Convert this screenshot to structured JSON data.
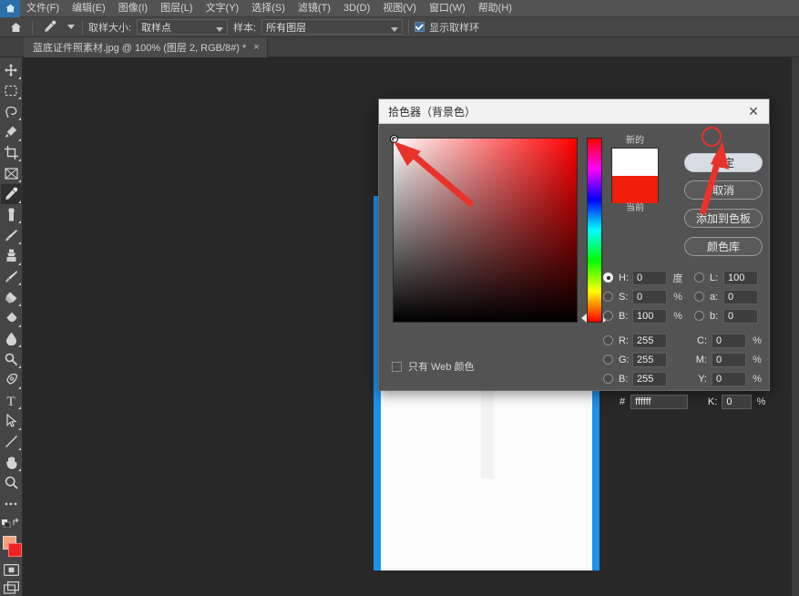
{
  "app": {
    "home_icon": "home-icon"
  },
  "menubar": {
    "items": [
      {
        "label": "文件(F)"
      },
      {
        "label": "编辑(E)"
      },
      {
        "label": "图像(I)"
      },
      {
        "label": "图层(L)"
      },
      {
        "label": "文字(Y)"
      },
      {
        "label": "选择(S)"
      },
      {
        "label": "滤镜(T)"
      },
      {
        "label": "3D(D)"
      },
      {
        "label": "视图(V)"
      },
      {
        "label": "窗口(W)"
      },
      {
        "label": "帮助(H)"
      }
    ]
  },
  "optionsbar": {
    "tool_icon": "eyedropper-icon",
    "sample_size_label": "取样大小:",
    "sample_size_value": "取样点",
    "sample_label": "样本:",
    "sample_value": "所有图层",
    "show_ring_label": "显示取样环",
    "show_ring_checked": true
  },
  "tabbar": {
    "document_title": "蓝底证件照素材.jpg @ 100% (图层 2, RGB/8#) *",
    "close_glyph": "×"
  },
  "toolbar": {
    "tools": [
      {
        "name": "move-tool"
      },
      {
        "name": "rectangular-marquee-tool"
      },
      {
        "name": "lasso-tool"
      },
      {
        "name": "quick-selection-tool"
      },
      {
        "name": "crop-tool"
      },
      {
        "name": "frame-tool"
      },
      {
        "name": "eyedropper-tool",
        "active": true
      },
      {
        "name": "spot-healing-brush-tool"
      },
      {
        "name": "brush-tool"
      },
      {
        "name": "clone-stamp-tool"
      },
      {
        "name": "history-brush-tool"
      },
      {
        "name": "eraser-tool"
      },
      {
        "name": "gradient-tool"
      },
      {
        "name": "blur-tool"
      },
      {
        "name": "dodge-tool"
      },
      {
        "name": "pen-tool"
      },
      {
        "name": "type-tool"
      },
      {
        "name": "path-selection-tool"
      },
      {
        "name": "line-tool"
      },
      {
        "name": "hand-tool"
      },
      {
        "name": "zoom-tool"
      },
      {
        "name": "edit-toolbar-tool"
      }
    ],
    "foreground_color": "#f3a178",
    "background_color": "#ee2222"
  },
  "dialog": {
    "title": "拾色器（背景色）",
    "close_glyph": "✕",
    "buttons": {
      "ok": "确定",
      "cancel": "取消",
      "add_to_swatches": "添加到色板",
      "color_libraries": "颜色库"
    },
    "preview": {
      "new_label": "新的",
      "current_label": "当前",
      "new_color": "#ffffff",
      "current_color": "#f01e0a"
    },
    "web_only": {
      "label": "只有 Web 颜色",
      "checked": false
    },
    "hsb": [
      {
        "key": "H:",
        "value": "0",
        "unit": "度",
        "selected": true
      },
      {
        "key": "S:",
        "value": "0",
        "unit": "%",
        "selected": false
      },
      {
        "key": "B:",
        "value": "100",
        "unit": "%",
        "selected": false
      }
    ],
    "lab": [
      {
        "key": "L:",
        "value": "100",
        "unit": "",
        "selected": false
      },
      {
        "key": "a:",
        "value": "0",
        "unit": "",
        "selected": false
      },
      {
        "key": "b:",
        "value": "0",
        "unit": "",
        "selected": false
      }
    ],
    "rgb": [
      {
        "key": "R:",
        "value": "255",
        "selected": false
      },
      {
        "key": "G:",
        "value": "255",
        "selected": false
      },
      {
        "key": "B:",
        "value": "255",
        "selected": false
      }
    ],
    "cmyk": [
      {
        "key": "C:",
        "value": "0",
        "unit": "%"
      },
      {
        "key": "M:",
        "value": "0",
        "unit": "%"
      },
      {
        "key": "Y:",
        "value": "0",
        "unit": "%"
      },
      {
        "key": "K:",
        "value": "0",
        "unit": "%"
      }
    ],
    "hex": {
      "symbol": "#",
      "value": "ffffff"
    },
    "field": {
      "hue_color": "#ff0000",
      "marker_position": "top-left"
    }
  },
  "annotations": {
    "arrow_color": "#e8332a",
    "circle_target": "确定",
    "arrows": [
      {
        "name": "arrow-to-color-field-marker"
      },
      {
        "name": "arrow-to-ok-button"
      }
    ]
  },
  "canvas": {
    "background": "#282828",
    "photo_background": "#1e90e8"
  }
}
